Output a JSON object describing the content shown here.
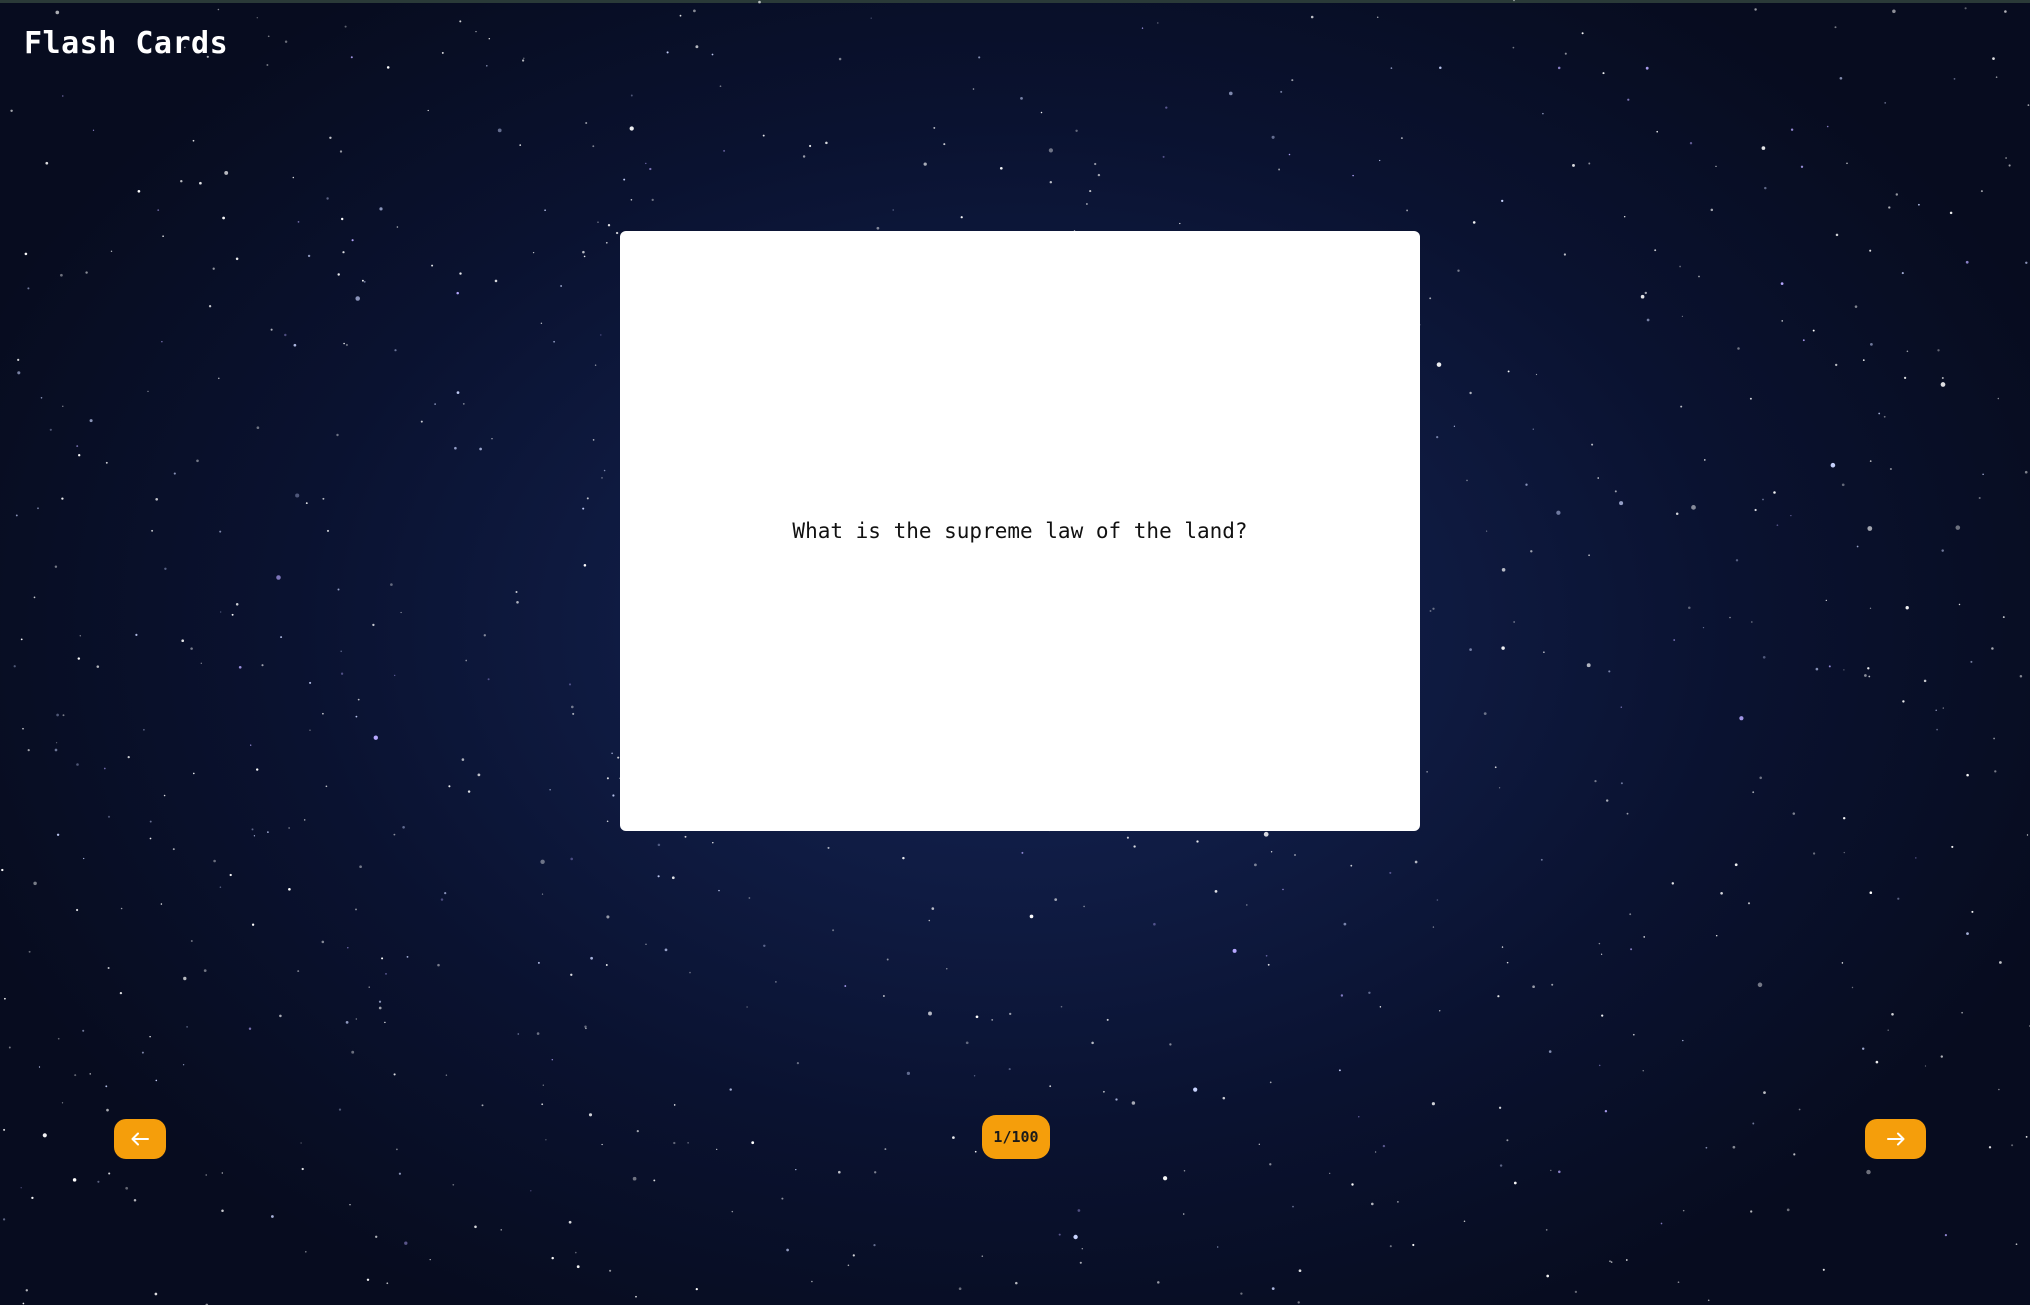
{
  "app": {
    "title": "Flash Cards"
  },
  "card": {
    "question": "What is the supreme law of the land?"
  },
  "navigation": {
    "prev_icon": "arrow-left-icon",
    "next_icon": "arrow-right-icon",
    "counter": "1/100"
  },
  "colors": {
    "accent": "#f59e0b",
    "background": "#0f1b42",
    "card": "#ffffff"
  }
}
